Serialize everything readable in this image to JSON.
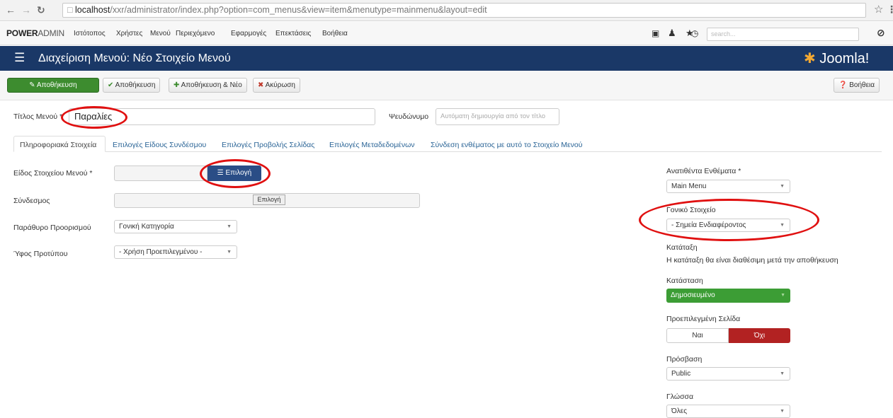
{
  "browser": {
    "url_host": "localhost",
    "url_path": "/xxr/administrator/index.php?option=com_menus&view=item&menutype=mainmenu&layout=edit"
  },
  "topnav": {
    "brand_bold": "POWER",
    "brand_rest": "ADMIN",
    "items": [
      "Ιστότοπος",
      "Χρήστες",
      "Μενού",
      "Περιεχόμενο",
      "Εφαρμογές",
      "Επεκτάσεις",
      "Βοήθεια"
    ],
    "search_placeholder": "search..."
  },
  "header": {
    "title": "Διαχείριση Μενού: Νέο Στοιχείο Μενού",
    "logo": "Joomla!"
  },
  "toolbar": {
    "save": "Αποθήκευση",
    "save_close": "Αποθήκευση",
    "save_new": "Αποθήκευση & Νέο",
    "cancel": "Ακύρωση",
    "help": "Βοήθεια"
  },
  "form": {
    "title_label": "Τίτλος Μενού *",
    "title_value": "Παραλίες",
    "alias_label": "Ψευδώνυμο",
    "alias_placeholder": "Αυτόματη δημιουργία από τον τίτλο"
  },
  "tabs": [
    "Πληροφοριακά Στοιχεία",
    "Επιλογές Είδους Συνδέσμου",
    "Επιλογές Προβολής Σελίδας",
    "Επιλογές Μεταδεδομένων",
    "Σύνδεση ενθέματος με αυτό το Στοιχείο Μενού"
  ],
  "details": {
    "type_label": "Είδος Στοιχείου Μενού *",
    "select_button": "Επιλογή",
    "link_label": "Σύνδεσμος",
    "link_button": "Επιλογή",
    "target_label": "Παράθυρο Προορισμού",
    "target_value": "Γονική Κατηγορία",
    "style_label": "Ύφος Προτύπου",
    "style_value": "- Χρήση Προεπιλεγμένου -"
  },
  "side": {
    "menu_label": "Ανατιθέντα Ενθέματα *",
    "menu_value": "Main Menu",
    "parent_label": "Γονικό Στοιχείο",
    "parent_value": "- Σημεία Ενδιαφέροντος",
    "order_label": "Κατάταξη",
    "order_note": "Η κατάταξη θα είναι διαθέσιμη μετά την αποθήκευση",
    "status_label": "Κατάσταση",
    "status_value": "Δημοσιευμένο",
    "home_label": "Προεπιλεγμένη Σελίδα",
    "home_yes": "Ναι",
    "home_no": "Όχι",
    "access_label": "Πρόσβαση",
    "access_value": "Public",
    "lang_label": "Γλώσσα",
    "lang_value": "Όλες"
  },
  "colors": {
    "header_bg": "#1a3867",
    "save_green": "#3d8c2f",
    "status_green": "#3c9d35",
    "no_red": "#b22222",
    "annotation_red": "#e01010"
  }
}
